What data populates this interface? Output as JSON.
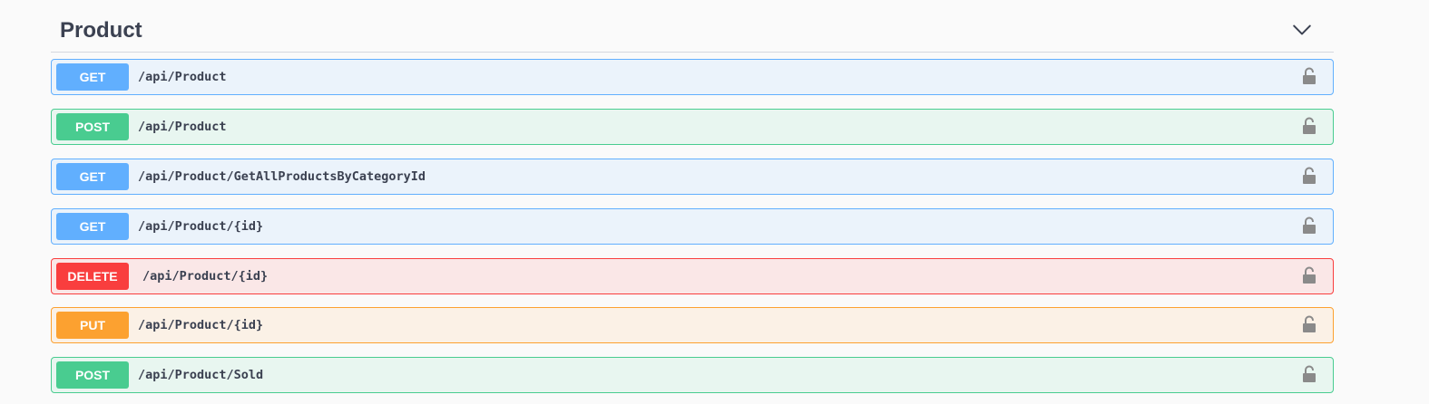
{
  "section": {
    "title": "Product",
    "toggle_icon": "chevron-down-icon"
  },
  "operations": [
    {
      "method": "GET",
      "path": "/api/Product",
      "lock_icon": "unlocked-padlock-icon"
    },
    {
      "method": "POST",
      "path": "/api/Product",
      "lock_icon": "unlocked-padlock-icon"
    },
    {
      "method": "GET",
      "path": "/api/Product/GetAllProductsByCategoryId",
      "lock_icon": "unlocked-padlock-icon"
    },
    {
      "method": "GET",
      "path": "/api/Product/{id}",
      "lock_icon": "unlocked-padlock-icon"
    },
    {
      "method": "DELETE",
      "path": "/api/Product/{id}",
      "lock_icon": "unlocked-padlock-icon"
    },
    {
      "method": "PUT",
      "path": "/api/Product/{id}",
      "lock_icon": "unlocked-padlock-icon"
    },
    {
      "method": "POST",
      "path": "/api/Product/Sold",
      "lock_icon": "unlocked-padlock-icon"
    }
  ],
  "colors": {
    "get": "#61affe",
    "post": "#49cc90",
    "delete": "#f93e3e",
    "put": "#fca130",
    "title": "#3b4151",
    "lock": "#8a8a8a"
  }
}
